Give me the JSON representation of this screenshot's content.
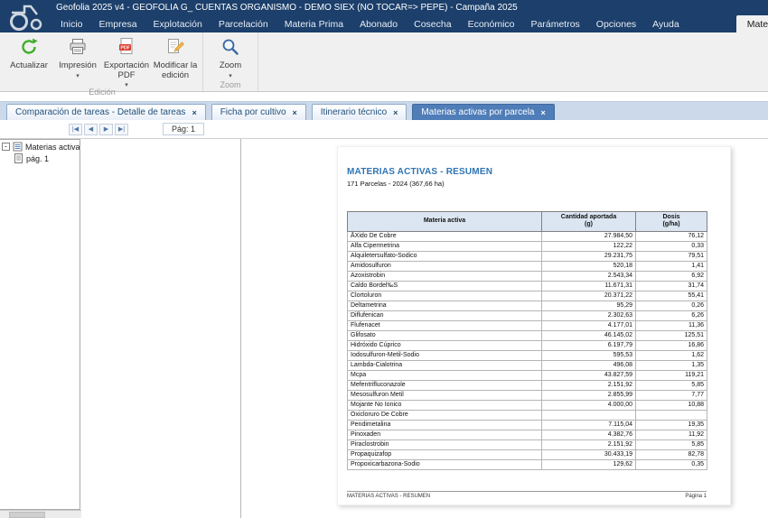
{
  "window": {
    "title": "Geofolia 2025 v4 - GEOFOLIA G_ CUENTAS ORGANISMO - DEMO SIEX (NO TOCAR=> PEPE) - Campaña 2025"
  },
  "menu": {
    "items": [
      "Inicio",
      "Empresa",
      "Explotación",
      "Parcelación",
      "Materia Prima",
      "Abonado",
      "Cosecha",
      "Económico",
      "Parámetros",
      "Opciones",
      "Ayuda"
    ],
    "active_item": "Materias activas por parcela"
  },
  "ribbon": {
    "buttons": {
      "refresh": "Actualizar",
      "print": "Impresión",
      "export_pdf": "Exportación PDF",
      "edit": "Modificar la edición",
      "zoom": "Zoom"
    },
    "groups": {
      "edition": "Edición",
      "zoom": "Zoom"
    }
  },
  "doc_tabs": [
    {
      "label": "Comparación de tareas - Detalle de tareas",
      "active": false
    },
    {
      "label": "Ficha por cultivo",
      "active": false
    },
    {
      "label": "Itinerario técnico",
      "active": false
    },
    {
      "label": "Materias activas por parcela",
      "active": true
    }
  ],
  "pager": {
    "page_field": "Pág: 1"
  },
  "tree": {
    "root": "Materias activas -Res",
    "children": [
      "pág. 1"
    ]
  },
  "report": {
    "title": "MATERIAS ACTIVAS - RESUMEN",
    "subtitle": "171 Parcelas - 2024 (367,66 ha)",
    "footer_left": "MATERIAS ACTIVAS - RESUMEN",
    "footer_right": "Página 1",
    "table": {
      "columns": [
        {
          "label": "Materia activa",
          "sub": ""
        },
        {
          "label": "Cantidad aportada",
          "sub": "(g)"
        },
        {
          "label": "Dosis",
          "sub": "(g/ha)"
        }
      ],
      "rows": [
        [
          "ÃXido De Cobre",
          "27.984,50",
          "76,12"
        ],
        [
          "Alfa Cipermetrina",
          "122,22",
          "0,33"
        ],
        [
          "Alquiletersulfato-Sodico",
          "29.231,75",
          "79,51"
        ],
        [
          "Amidosulfuron",
          "520,18",
          "1,41"
        ],
        [
          "Azoxistrobin",
          "2.543,34",
          "6,92"
        ],
        [
          "Caldo Bordel‰S",
          "11.671,31",
          "31,74"
        ],
        [
          "Clortoluron",
          "20.371,22",
          "55,41"
        ],
        [
          "Deltametrina",
          "95,29",
          "0,26"
        ],
        [
          "Diflufenican",
          "2.302,63",
          "6,26"
        ],
        [
          "Flufenacet",
          "4.177,01",
          "11,36"
        ],
        [
          "Glifosato",
          "46.145,02",
          "125,51"
        ],
        [
          "Hidróxido Cúprico",
          "6.197,79",
          "16,86"
        ],
        [
          "Iodosulfuron-Metil-Sodio",
          "595,53",
          "1,62"
        ],
        [
          "Lambda-Cialotrina",
          "496,08",
          "1,35"
        ],
        [
          "Mcpa",
          "43.827,59",
          "119,21"
        ],
        [
          "Mefentrifluconazole",
          "2.151,92",
          "5,85"
        ],
        [
          "Mesosulfuron Metil",
          "2.855,99",
          "7,77"
        ],
        [
          "Mojante No Ionico",
          "4.000,00",
          "10,88"
        ],
        [
          "Oxicloruro De Cobre",
          "",
          ""
        ],
        [
          "Pendimetalina",
          "7.115,04",
          "19,35"
        ],
        [
          "Pinoxaden",
          "4.382,76",
          "11,92"
        ],
        [
          "Piraclostrobin",
          "2.151,92",
          "5,85"
        ],
        [
          "Propaquizafop",
          "30.433,19",
          "82,78"
        ],
        [
          "Propoxicarbazona-Sodio",
          "129,62",
          "0,35"
        ]
      ]
    }
  },
  "colors": {
    "titlebar": "#1c3f6b",
    "active_doc_tab": "#4f7db8",
    "tabstrip_bg": "#ccd9ea",
    "table_header_bg": "#dce6f2",
    "report_title": "#2e74b5",
    "refresh_green": "#3fae2a",
    "pdf_red": "#d63b2f"
  }
}
